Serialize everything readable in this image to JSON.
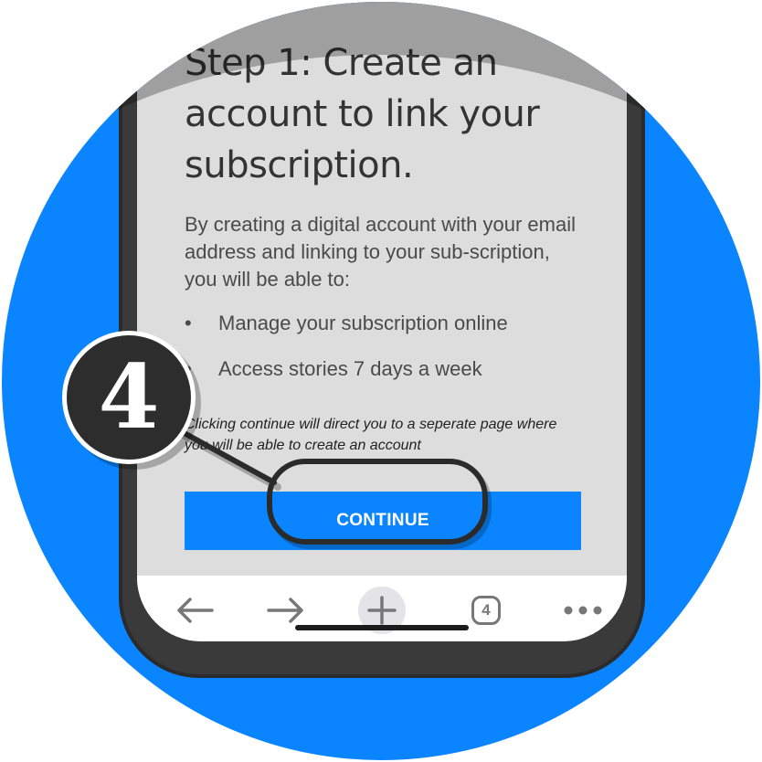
{
  "page": {
    "heading": "Step 1: Create an account to link your subscription.",
    "intro": "By creating a digital account with your email address and linking to your sub-scription, you will be able to:",
    "benefits": [
      "Manage your subscription online",
      "Access stories 7 days a week"
    ],
    "bullet_char": "•",
    "note": "Clicking continue will direct you to a seperate page where you will be able to create an account",
    "continue_label": "CONTINUE"
  },
  "callout": {
    "step_number": "4"
  },
  "toolbar": {
    "tab_count": "4",
    "icons": [
      "back-arrow-icon",
      "forward-arrow-icon",
      "plus-icon",
      "tabs-icon",
      "more-icon"
    ]
  },
  "colors": {
    "accent": "#0a84ff",
    "screen_bg": "#dddddd",
    "phone_frame": "#3a3a3a",
    "badge": "#2d2d2d"
  }
}
